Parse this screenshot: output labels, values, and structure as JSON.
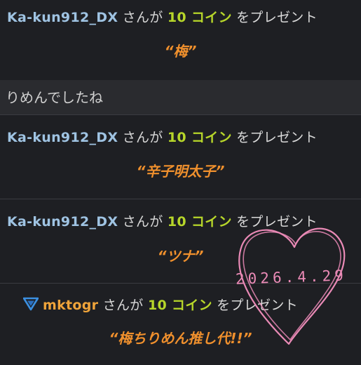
{
  "feed": {
    "gifts": [
      {
        "sender": "Ka-kun912_DX",
        "connector": " さんが ",
        "amount": "10 コイン",
        "action": " をプレゼント",
        "message": "“梅”"
      },
      {
        "sender": "Ka-kun912_DX",
        "connector": " さんが ",
        "amount": "10 コイン",
        "action": " をプレゼント",
        "message": "“辛子明太子”"
      },
      {
        "sender": "Ka-kun912_DX",
        "connector": " さんが ",
        "amount": "10 コイン",
        "action": " をプレゼント",
        "message": "“ツナ”"
      },
      {
        "sender": "mktogr",
        "connector": " さんが ",
        "amount": "10 コイン",
        "action": " をプレゼント",
        "message": "“梅ちりめん推し代!!”",
        "badge_icon": "v-shield-badge-icon"
      }
    ],
    "chat_message": "りめんでしたね"
  },
  "overlay": {
    "date_text": "2026.4.29",
    "heart_icon": "hand-drawn-heart-icon",
    "ink_color": "#ea8ab6"
  },
  "colors": {
    "background": "#1e1f23",
    "sender_blue": "#9fc3e2",
    "coin_green": "#b7d62a",
    "message_orange": "#f0902d",
    "sender_orange": "#f0a43a",
    "badge_blue": "#3b8fe0"
  }
}
